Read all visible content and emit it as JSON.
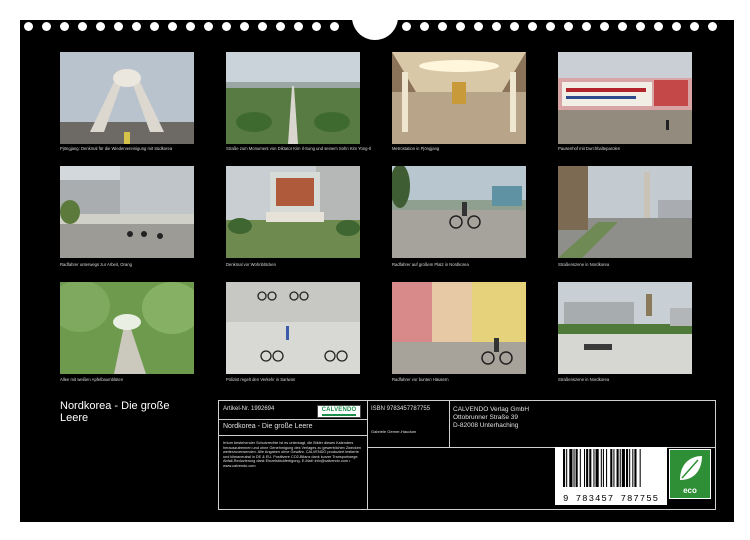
{
  "photos": [
    {
      "caption": "Pjöngjang: Denkmal für die Wiedervereinigung mit Südkorea"
    },
    {
      "caption": "Straße zum Monument von Diktator Kim Il-Sung und seinem Sohn Kim Yong-Il"
    },
    {
      "caption": "Metrostation in Pjöngjang"
    },
    {
      "caption": "Pausenhof mit Durchhalteparolen"
    },
    {
      "caption": "Radfahrer unterwegs zur Arbeit, Orang"
    },
    {
      "caption": "Denkmal vor Wohnblöcken"
    },
    {
      "caption": "Radfahrer auf großem Platz in Nordkorea"
    },
    {
      "caption": "Straßenszene in Nordkorea"
    },
    {
      "caption": "Allee mit weißen Apfelbaumblüten"
    },
    {
      "caption": "Polizist regelt den Verkehr in Sariwon"
    },
    {
      "caption": "Radfahrer vor bunten Häusern"
    },
    {
      "caption": "Straßenszene in Nordkorea"
    }
  ],
  "info": {
    "title": "Nordkorea - Die große Leere",
    "article": "Artikel-Nr. 1992694",
    "publisher_logo": "CALVENDO",
    "isbn": "ISBN 9783457787755",
    "subtitle": "Nordkorea - Die große Leere",
    "author": "Gabriele Gerner-Haudum",
    "legal": "Irrtum bestehender Schutzrechte ist es untersagt, die Bilder dieses Kalenders herauszutrennen und ohne Genehmigung des Verlages zu gewerblichen Zwecken weiterzuverwenden. Alle Angaben ohne Gewähr. CALVENDO produziert testierte und klimaneutral in DE & EU. Positivere CO2-Bilanz dank kurzer Transportwege. Abfall-Reduzierung dank Einzelstückfertigung. E-Mail: info@calvendo.com • www.calvendo.com",
    "address": [
      "CALVENDO Verlag GmbH",
      "Ottobrunner Straße 39",
      "D-82008 Unterhaching"
    ],
    "barcode_number": "9 783457 787755",
    "eco_label": "eco"
  }
}
